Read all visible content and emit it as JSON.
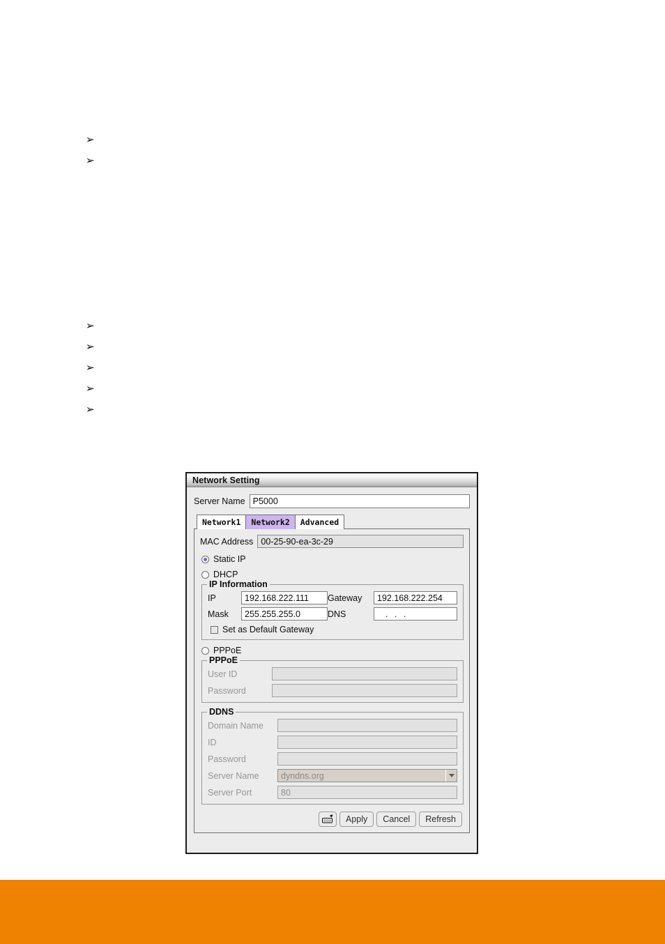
{
  "page": {
    "bullet_glyph": "➢",
    "upper_bullets": [
      {
        "name": "bullet-item-1",
        "text": ""
      },
      {
        "name": "bullet-item-2",
        "text": ""
      }
    ],
    "lower_bullets": [
      {
        "name": "bullet-item-3",
        "text": ""
      },
      {
        "name": "bullet-item-4",
        "text": ""
      },
      {
        "name": "bullet-item-5",
        "text": ""
      },
      {
        "name": "bullet-item-6",
        "text": ""
      },
      {
        "name": "bullet-item-7",
        "text": ""
      }
    ],
    "footer_color": "#ef8200"
  },
  "dialog": {
    "title": "Network Setting",
    "server_name": {
      "label": "Server Name",
      "value": "P5000",
      "placeholder": ""
    },
    "tabs": [
      {
        "label": "Network1",
        "selected": false
      },
      {
        "label": "Network2",
        "selected": true
      },
      {
        "label": "Advanced",
        "selected": false
      }
    ],
    "tab_selected_color": "#cdb5ef",
    "mac": {
      "label": "MAC Address",
      "value": "00-25-90-ea-3c-29"
    },
    "mode": {
      "static_ip": {
        "label": "Static IP",
        "selected": true
      },
      "dhcp": {
        "label": "DHCP",
        "selected": false
      },
      "pppoe": {
        "label": "PPPoE",
        "selected": false
      },
      "selected_dot_color": "#7b5fc4"
    },
    "ip_information": {
      "title": "IP Information",
      "ip": {
        "label": "IP",
        "value": "192.168.222.111"
      },
      "gateway": {
        "label": "Gateway",
        "value": "192.168.222.254"
      },
      "mask": {
        "label": "Mask",
        "value": "255.255.255.0"
      },
      "dns": {
        "label": "DNS",
        "value": ". . ."
      },
      "default_gateway": {
        "label": "Set as Default Gateway",
        "checked": false
      }
    },
    "pppoe_group": {
      "title": "PPPoE",
      "user_id": {
        "label": "User ID",
        "value": ""
      },
      "password": {
        "label": "Password",
        "value": ""
      }
    },
    "ddns_group": {
      "title": "DDNS",
      "domain_name": {
        "label": "Domain Name",
        "value": ""
      },
      "id": {
        "label": "ID",
        "value": ""
      },
      "password": {
        "label": "Password",
        "value": ""
      },
      "server_name": {
        "label": "Server Name",
        "value": "dyndns.org"
      },
      "server_port": {
        "label": "Server Port",
        "value": "80"
      }
    },
    "buttons": [
      {
        "name": "virtual-keyboard-button",
        "label": "",
        "icon": "keyboard-icon"
      },
      {
        "name": "apply-button",
        "label": "Apply",
        "icon": ""
      },
      {
        "name": "cancel-button",
        "label": "Cancel",
        "icon": ""
      },
      {
        "name": "refresh-button",
        "label": "Refresh",
        "icon": ""
      }
    ]
  }
}
